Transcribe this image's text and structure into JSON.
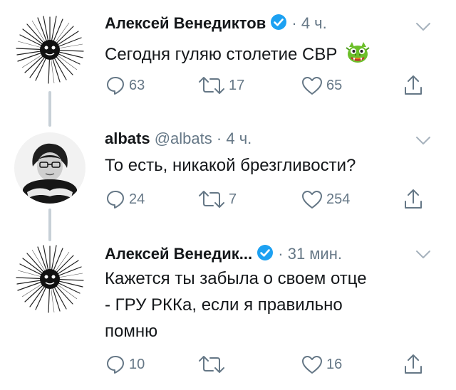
{
  "tweets": [
    {
      "name": "Алексей Венедиктов",
      "handle": "",
      "verified": true,
      "time": "4 ч.",
      "text": "Сегодня гуляю столетие СВР",
      "emoji_icon": "dragon-face-icon",
      "replies": "63",
      "retweets": "17",
      "likes": "65"
    },
    {
      "name": "albats",
      "handle": "@albats",
      "verified": false,
      "time": "4 ч.",
      "text": "То есть, никакой брезгливости?",
      "replies": "24",
      "retweets": "7",
      "likes": "254"
    },
    {
      "name": "Алексей Венедик...",
      "handle": "",
      "verified": true,
      "time": "31 мин.",
      "text_lines": [
        "Кажется ты забыла о своем отце",
        "- ГРУ РККа, если я правильно",
        "помню"
      ],
      "replies": "10",
      "retweets": "",
      "likes": "16"
    }
  ],
  "separator": "·",
  "colors": {
    "text": "#14171a",
    "muted": "#657786",
    "verified": "#1da1f2",
    "thread_line": "#c7d0d7"
  }
}
